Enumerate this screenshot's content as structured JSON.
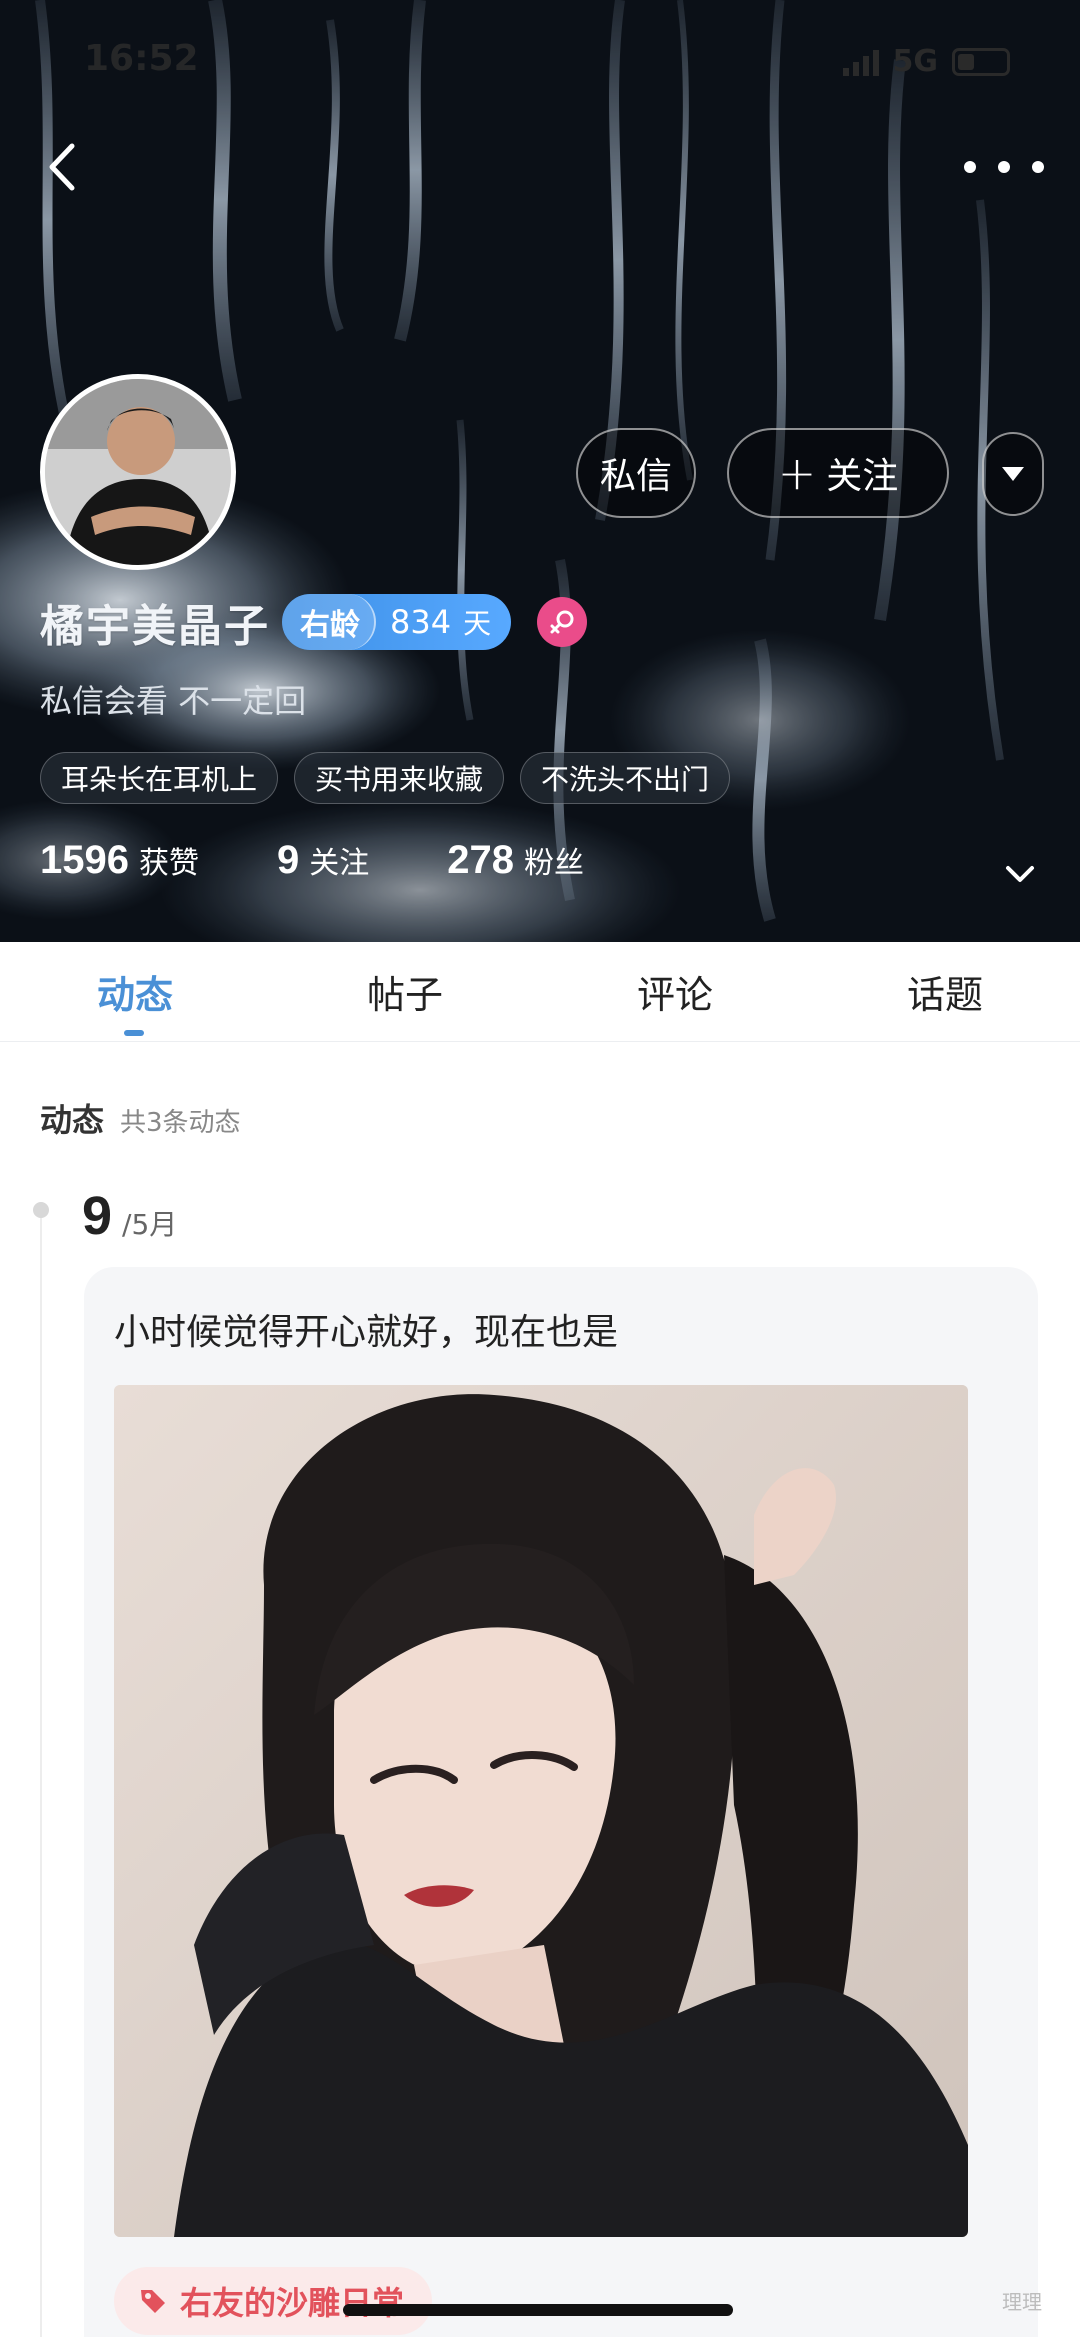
{
  "status_bar": {
    "time": "16:52",
    "network": "5G"
  },
  "profile": {
    "username": "橘宇美晶子",
    "age_label": "右龄",
    "age_value": "834",
    "age_unit": "天",
    "gender": "female",
    "signature": "私信会看 不一定回",
    "tags": [
      "耳朵长在耳机上",
      "买书用来收藏",
      "不洗头不出门"
    ],
    "stats": [
      {
        "value": "1596",
        "label": "获赞"
      },
      {
        "value": "9",
        "label": "关注"
      },
      {
        "value": "278",
        "label": "粉丝"
      }
    ],
    "message_button": "私信",
    "follow_button": "关注"
  },
  "tabs": [
    {
      "label": "动态",
      "active": true
    },
    {
      "label": "帖子",
      "active": false
    },
    {
      "label": "评论",
      "active": false
    },
    {
      "label": "话题",
      "active": false
    }
  ],
  "feed": {
    "title": "动态",
    "count_text": "共3条动态",
    "posts": [
      {
        "day": "9",
        "month": "/5月",
        "text": "小时候觉得开心就好，现在也是",
        "topic": "右友的沙雕日常"
      }
    ]
  },
  "watermark": "理理",
  "colors": {
    "accent": "#4a90d6",
    "age_badge": "#4a9cf0",
    "gender_female": "#ea4c8a",
    "topic": "#e2525c"
  },
  "icons": [
    "back-icon",
    "more-icon",
    "plus-icon",
    "dropdown-icon",
    "female-icon",
    "chevron-down-icon",
    "tag-icon"
  ]
}
